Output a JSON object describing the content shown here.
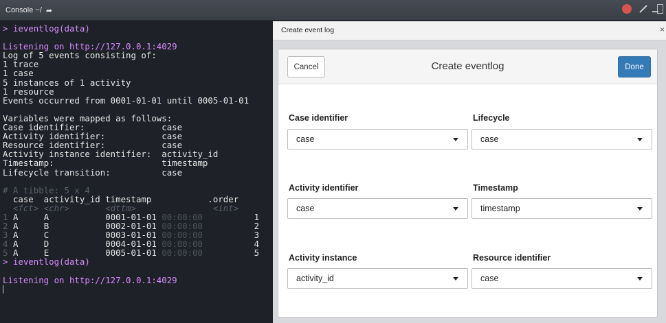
{
  "header": {
    "title": "Console ~/"
  },
  "console": {
    "lines": {
      "l1": "> ieventlog(data)",
      "l2": "Listening on http://127.0.0.1:4029",
      "l3": "Log of 5 events consisting of:",
      "l4": "1 trace",
      "l5": "1 case",
      "l6": "5 instances of 1 activity",
      "l7": "1 resource",
      "l8": "Events occurred from 0001-01-01 until 0005-01-01",
      "l9": "Variables were mapped as follows:",
      "l10": "Case identifier:               case",
      "l11": "Activity identifier:           case",
      "l12": "Resource identifier:           case",
      "l13": "Activity instance identifier:  activity_id",
      "l14": "Timestamp:                     timestamp",
      "l15": "Lifecycle transition:          case",
      "tibble_header": "# A tibble: 5 x 4",
      "col_header": "  case  activity_id timestamp           .order",
      "type_header": "  <fct> <chr>       <dttm>               <int>",
      "rows": [
        {
          "num": "1",
          "case": "A",
          "act": "A",
          "date": "0001-01-01",
          "time": "00:00:00",
          "order": "1"
        },
        {
          "num": "2",
          "case": "A",
          "act": "B",
          "date": "0002-01-01",
          "time": "00:00:00",
          "order": "2"
        },
        {
          "num": "3",
          "case": "A",
          "act": "C",
          "date": "0003-01-01",
          "time": "00:00:00",
          "order": "3"
        },
        {
          "num": "4",
          "case": "A",
          "act": "D",
          "date": "0004-01-01",
          "time": "00:00:00",
          "order": "4"
        },
        {
          "num": "5",
          "case": "A",
          "act": "E",
          "date": "0005-01-01",
          "time": "00:00:00",
          "order": "5"
        }
      ],
      "l16": "> ieventlog(data)",
      "l17": "Listening on http://127.0.0.1:4029"
    }
  },
  "viewer": {
    "title": "Create event log",
    "close": "×"
  },
  "dialog": {
    "cancel_label": "Cancel",
    "title": "Create eventlog",
    "done_label": "Done",
    "fields": {
      "case_id": {
        "label": "Case identifier",
        "value": "case"
      },
      "lifecycle": {
        "label": "Lifecycle",
        "value": "case"
      },
      "activity_id": {
        "label": "Activity identifier",
        "value": "case"
      },
      "timestamp": {
        "label": "Timestamp",
        "value": "timestamp"
      },
      "activity_instance": {
        "label": "Activity instance",
        "value": "activity_id"
      },
      "resource_id": {
        "label": "Resource identifier",
        "value": "case"
      }
    }
  },
  "colors": {
    "console_bg": "#1e2228",
    "prompt": "#d58cff",
    "done_button": "#337ab7"
  }
}
